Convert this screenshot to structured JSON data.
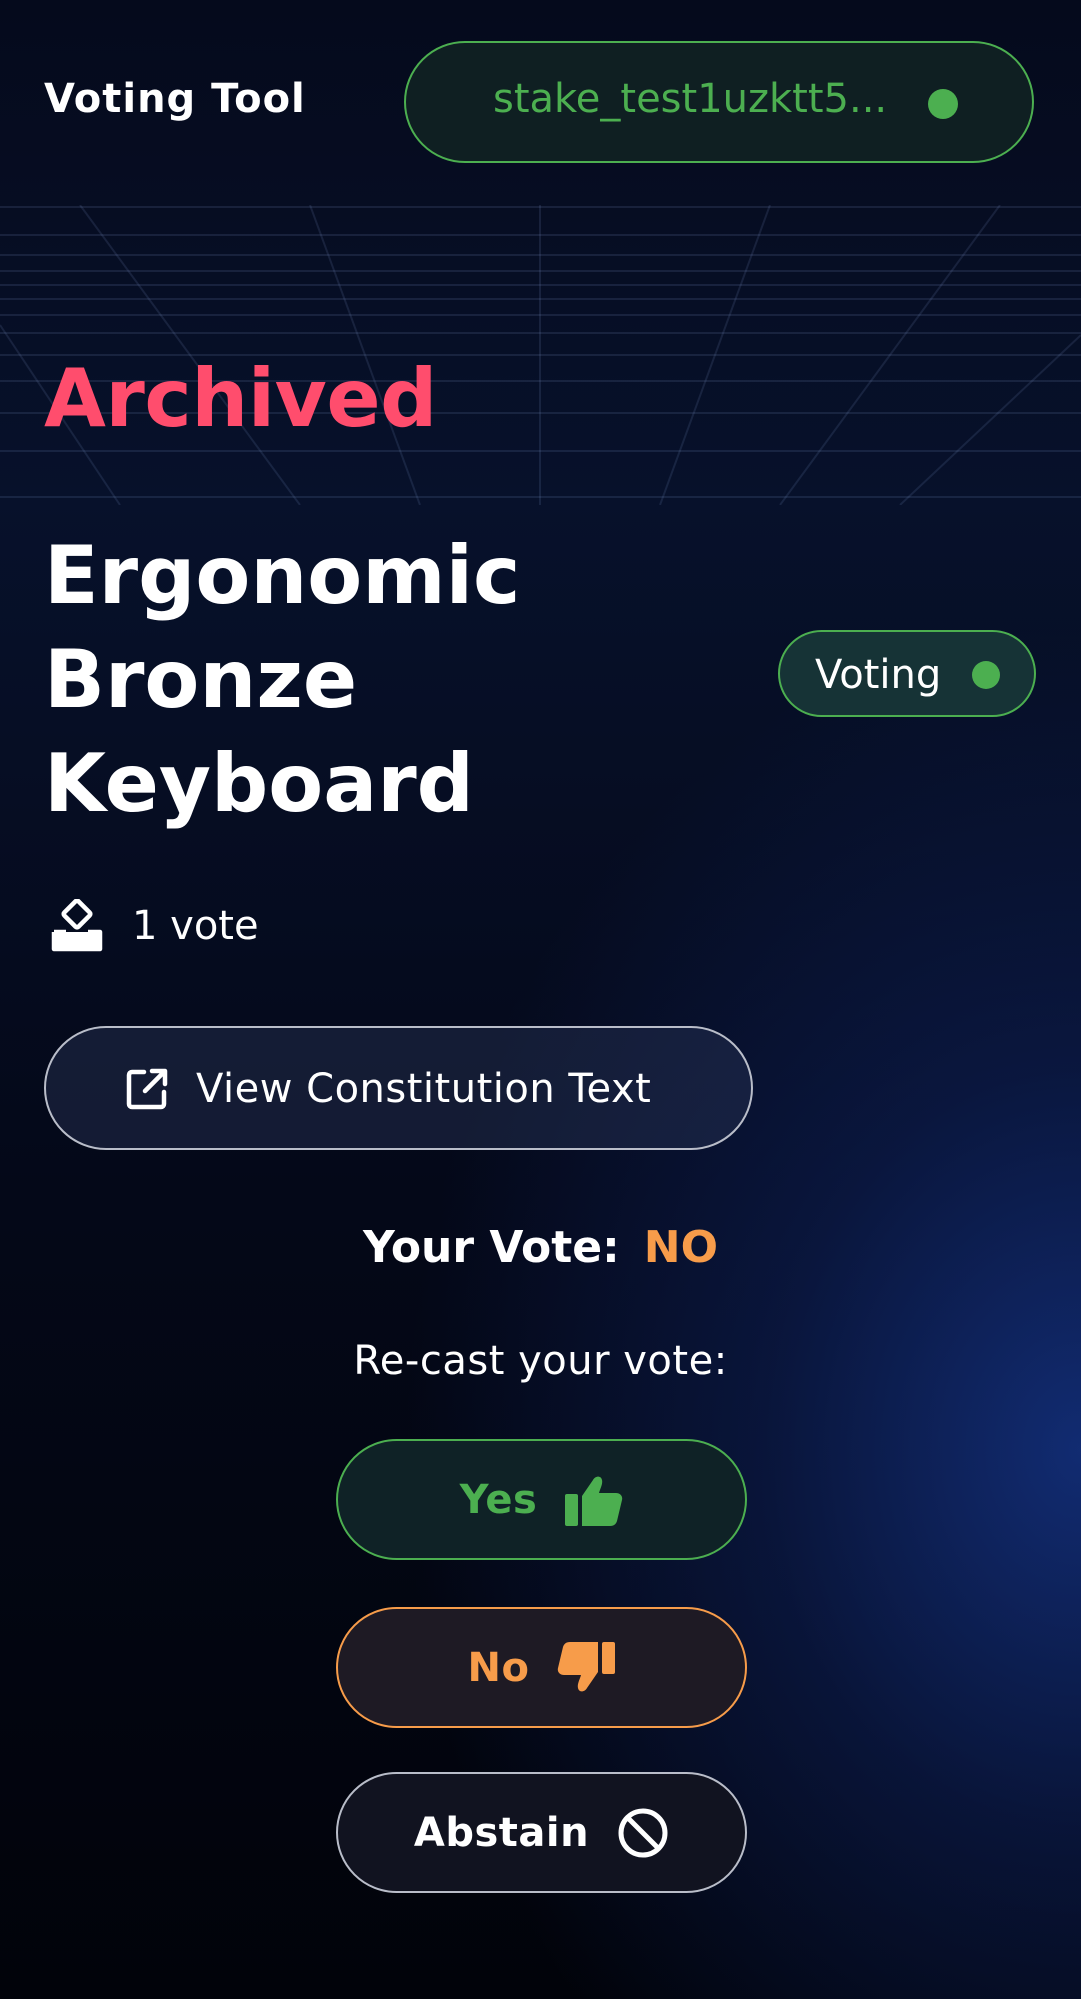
{
  "header": {
    "title": "Voting Tool",
    "wallet_address": "stake_test1uzktt5...",
    "wallet_status_color": "#4caf50"
  },
  "proposal": {
    "archived_label": "Archived",
    "title": "Ergonomic Bronze Keyboard",
    "status_label": "Voting",
    "vote_count": "1 vote",
    "constitution_button": "View Constitution Text"
  },
  "vote": {
    "your_vote_label": "Your Vote:",
    "your_vote_value": "NO",
    "recast_prompt": "Re-cast your vote:",
    "options": {
      "yes": "Yes",
      "no": "No",
      "abstain": "Abstain"
    }
  },
  "colors": {
    "accent_green": "#4caf50",
    "accent_orange": "#f79c4a",
    "archived_red": "#ff4d6d",
    "background": "#050a1c"
  },
  "icons": {
    "ballot": "ballot-box-icon",
    "external": "external-link-icon",
    "yes": "thumbs-up-icon",
    "no": "thumbs-down-icon",
    "abstain": "ban-icon"
  }
}
